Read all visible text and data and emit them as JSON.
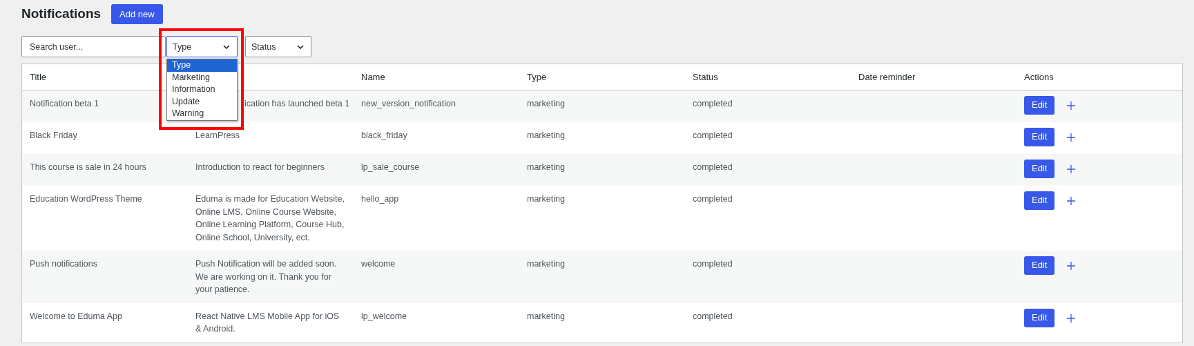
{
  "page": {
    "title": "Notifications",
    "add_button": "Add new"
  },
  "filters": {
    "search": {
      "placeholder": "Search user..."
    },
    "type_select": {
      "value": "Type",
      "expanded": true,
      "options": [
        {
          "label": "Type",
          "selected": true
        },
        {
          "label": "Marketing",
          "selected": false
        },
        {
          "label": "Information",
          "selected": false
        },
        {
          "label": "Update",
          "selected": false
        },
        {
          "label": "Warning",
          "selected": false
        }
      ]
    },
    "status_select": {
      "value": "Status"
    }
  },
  "table": {
    "columns": [
      "Title",
      "Name",
      "Type",
      "Status",
      "Date reminder",
      "Actions"
    ],
    "rows": [
      {
        "title": "Notification beta 1",
        "column_2": "ication has launched beta 1",
        "name": "new_version_notification",
        "type": "marketing",
        "status": "completed",
        "edit": "Edit"
      },
      {
        "title": "Black Friday",
        "column_2": "LearnPress",
        "name": "black_friday",
        "type": "marketing",
        "status": "completed",
        "edit": "Edit"
      },
      {
        "title": "This course is sale in 24 hours",
        "column_2": "Introduction to react for beginners",
        "name": "lp_sale_course",
        "type": "marketing",
        "status": "completed",
        "edit": "Edit"
      },
      {
        "title": "Education WordPress Theme",
        "column_2": "Eduma is made for Education Website, Online LMS, Online Course Website, Online Learning Platform, Course Hub, Online School, University, ect.",
        "name": "hello_app",
        "type": "marketing",
        "status": "completed",
        "edit": "Edit"
      },
      {
        "title": "Push notifications",
        "column_2": "Push Notification will be added soon. We are working on it. Thank you for your patience.",
        "name": "welcome",
        "type": "marketing",
        "status": "completed",
        "edit": "Edit"
      },
      {
        "title": "Welcome to Eduma App",
        "column_2": "React Native LMS Mobile App for iOS & Android.",
        "name": "lp_welcome",
        "type": "marketing",
        "status": "completed",
        "edit": "Edit"
      }
    ]
  }
}
